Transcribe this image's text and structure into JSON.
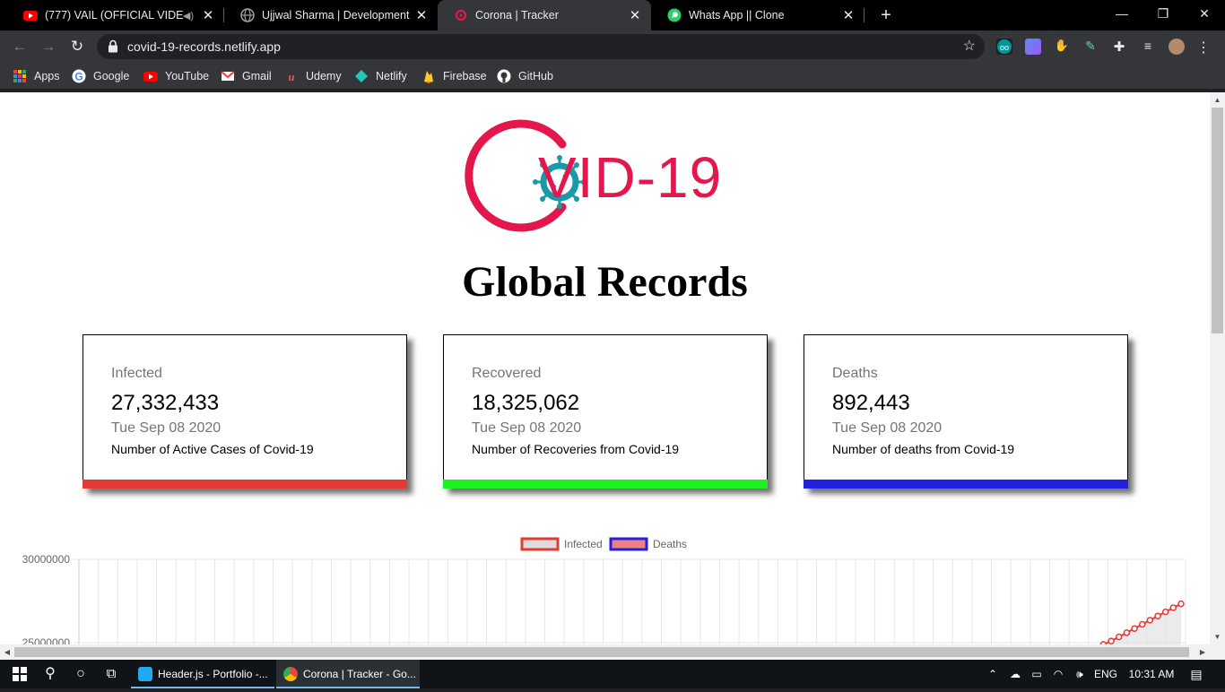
{
  "browser": {
    "tabs": [
      {
        "title": "(777) VAIL (OFFICIAL VIDEO)",
        "icon": "youtube-icon",
        "active": false
      },
      {
        "title": "Ujjwal Sharma | Development",
        "icon": "globe-icon",
        "active": false
      },
      {
        "title": "Corona | Tracker",
        "icon": "virus-icon",
        "active": true
      },
      {
        "title": "Whats App || Clone",
        "icon": "whatsapp-icon",
        "active": false
      }
    ],
    "new_tab_label": "+",
    "url": "covid-19-records.netlify.app",
    "bookmarks": [
      {
        "label": "Apps",
        "icon": "apps-grid-icon",
        "color": "#e8eaed"
      },
      {
        "label": "Google",
        "icon": "google-icon",
        "color": "#4285f4"
      },
      {
        "label": "YouTube",
        "icon": "youtube-icon",
        "color": "#ff0000"
      },
      {
        "label": "Gmail",
        "icon": "gmail-icon",
        "color": "#ea4335"
      },
      {
        "label": "Udemy",
        "icon": "udemy-icon",
        "color": "#ec5252"
      },
      {
        "label": "Netlify",
        "icon": "netlify-icon",
        "color": "#20c6b7"
      },
      {
        "label": "Firebase",
        "icon": "firebase-icon",
        "color": "#ffca28"
      },
      {
        "label": "GitHub",
        "icon": "github-icon",
        "color": "#ffffff"
      }
    ]
  },
  "page": {
    "logo_text": "VID-19",
    "heading": "Global Records",
    "cards": [
      {
        "label": "Infected",
        "value": "27,332,433",
        "date": "Tue Sep 08 2020",
        "desc": "Number of Active Cases of Covid-19",
        "color": "#e53935"
      },
      {
        "label": "Recovered",
        "value": "18,325,062",
        "date": "Tue Sep 08 2020",
        "desc": "Number of Recoveries from Covid-19",
        "color": "#1ef21e"
      },
      {
        "label": "Deaths",
        "value": "892,443",
        "date": "Tue Sep 08 2020",
        "desc": "Number of deaths from Covid-19",
        "color": "#2121e0"
      }
    ]
  },
  "chart_data": {
    "type": "line",
    "series": [
      {
        "name": "Infected",
        "border": "#e53935",
        "fill": "#dddddd"
      },
      {
        "name": "Deaths",
        "border": "#2121e0",
        "fill": "#f08080"
      }
    ],
    "y_ticks": [
      "30000000",
      "25000000"
    ],
    "ylim_visible": [
      25000000,
      30000000
    ],
    "grid": true,
    "legend_position": "top",
    "visible_infected_tail": [
      24900000,
      25100000,
      25350000,
      25600000,
      25850000,
      26100000,
      26350000,
      26600000,
      26850000,
      27100000,
      27332433
    ]
  },
  "taskbar": {
    "apps": [
      {
        "label": "Header.js - Portfolio -...",
        "icon": "vscode-icon",
        "color": "#23a9f2"
      },
      {
        "label": "Corona | Tracker - Go...",
        "icon": "chrome-icon",
        "color": "#e8453c"
      }
    ],
    "language": "ENG",
    "time": "10:31 AM"
  }
}
